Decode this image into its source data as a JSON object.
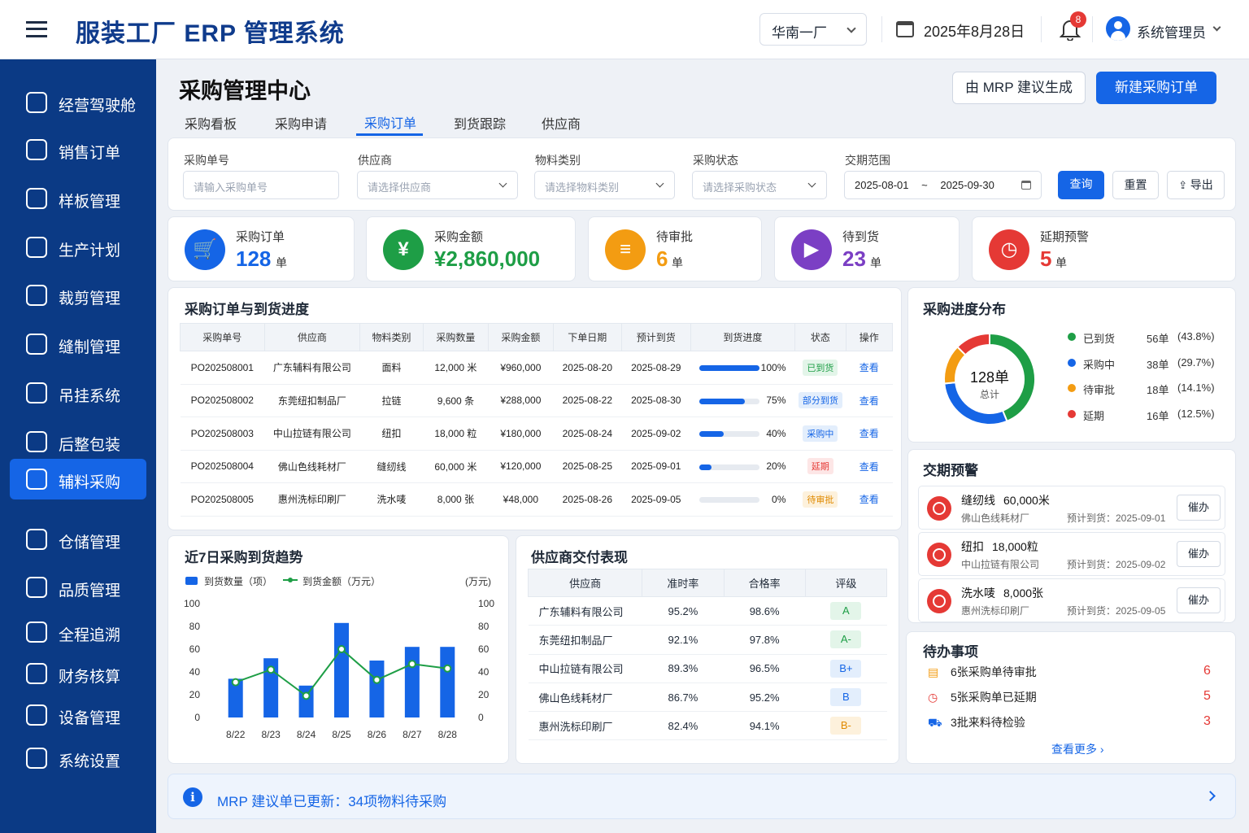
{
  "header": {
    "app_title": "服装工厂 ERP 管理系统",
    "factory": "华南一厂",
    "date": "2025年8月28日",
    "notify_count": "8",
    "user": "系统管理员"
  },
  "sidebar": {
    "items": [
      {
        "label": "经营驾驶舱",
        "icon": "dashboard-icon"
      },
      {
        "label": "销售订单",
        "icon": "document-icon"
      },
      {
        "label": "样板管理",
        "icon": "shirt-icon"
      },
      {
        "label": "生产计划",
        "icon": "calendar-icon"
      },
      {
        "label": "裁剪管理",
        "icon": "scissors-icon"
      },
      {
        "label": "缝制管理",
        "icon": "sewing-icon"
      },
      {
        "label": "吊挂系统",
        "icon": "hanger-icon"
      },
      {
        "label": "后整包装",
        "icon": "package-icon"
      },
      {
        "label": "辅料采购",
        "icon": "cart-icon",
        "active": true
      },
      {
        "label": "仓储管理",
        "icon": "warehouse-icon"
      },
      {
        "label": "品质管理",
        "icon": "shield-icon"
      },
      {
        "label": "全程追溯",
        "icon": "trace-icon"
      },
      {
        "label": "财务核算",
        "icon": "yen-icon"
      },
      {
        "label": "设备管理",
        "icon": "gear-icon"
      },
      {
        "label": "系统设置",
        "icon": "settings-icon"
      }
    ]
  },
  "page": {
    "title": "采购管理中心",
    "mrp_button": "由 MRP 建议生成",
    "new_button": "新建采购订单",
    "tabs": [
      "采购看板",
      "采购申请",
      "采购订单",
      "到货跟踪",
      "供应商"
    ],
    "active_tab": "采购订单"
  },
  "filters": {
    "order_no": {
      "label": "采购单号",
      "placeholder": "请输入采购单号"
    },
    "supplier": {
      "label": "供应商",
      "placeholder": "请选择供应商"
    },
    "category": {
      "label": "物料类别",
      "placeholder": "请选择物料类别"
    },
    "status": {
      "label": "采购状态",
      "placeholder": "请选择采购状态"
    },
    "date_range": {
      "label": "交期范围",
      "start": "2025-08-01",
      "sep": "~",
      "end": "2025-09-30"
    },
    "query": "查询",
    "reset": "重置",
    "export": "导出"
  },
  "kpis": [
    {
      "label": "采购订单",
      "value": "128",
      "unit": "单",
      "color": "#1565e6",
      "icon": "cart-icon"
    },
    {
      "label": "采购金额",
      "value": "¥2,860,000",
      "unit": "",
      "color": "#1e9e46",
      "icon": "money-icon"
    },
    {
      "label": "待审批",
      "value": "6",
      "unit": "单",
      "color": "#f39c12",
      "icon": "clipboard-icon"
    },
    {
      "label": "待到货",
      "value": "23",
      "unit": "单",
      "color": "#7b3fc4",
      "icon": "truck-icon"
    },
    {
      "label": "延期预警",
      "value": "5",
      "unit": "单",
      "color": "#e53935",
      "icon": "clock-icon"
    }
  ],
  "orders": {
    "title": "采购订单与到货进度",
    "headers": [
      "采购单号",
      "供应商",
      "物料类别",
      "采购数量",
      "采购金额",
      "下单日期",
      "预计到货",
      "到货进度",
      "状态",
      "操作"
    ],
    "rows": [
      {
        "no": "PO202508001",
        "supplier": "广东辅料有限公司",
        "cat": "面料",
        "qty": "12,000 米",
        "amt": "¥960,000",
        "order": "2025-08-20",
        "eta": "2025-08-29",
        "progress": 100,
        "pct": "100%",
        "status": "已到货",
        "status_color": "#1e9e46",
        "status_bg": "#e3f5e9",
        "action": "查看"
      },
      {
        "no": "PO202508002",
        "supplier": "东莞纽扣制品厂",
        "cat": "拉链",
        "qty": "9,600 条",
        "amt": "¥288,000",
        "order": "2025-08-22",
        "eta": "2025-08-30",
        "progress": 75,
        "pct": "75%",
        "status": "部分到货",
        "status_color": "#1565e6",
        "status_bg": "#e3eefc",
        "action": "查看"
      },
      {
        "no": "PO202508003",
        "supplier": "中山拉链有限公司",
        "cat": "纽扣",
        "qty": "18,000 粒",
        "amt": "¥180,000",
        "order": "2025-08-24",
        "eta": "2025-09-02",
        "progress": 40,
        "pct": "40%",
        "status": "采购中",
        "status_color": "#1565e6",
        "status_bg": "#e3eefc",
        "action": "查看"
      },
      {
        "no": "PO202508004",
        "supplier": "佛山色线耗材厂",
        "cat": "缝纫线",
        "qty": "60,000 米",
        "amt": "¥120,000",
        "order": "2025-08-25",
        "eta": "2025-09-01",
        "progress": 20,
        "pct": "20%",
        "status": "延期",
        "status_color": "#e53935",
        "status_bg": "#fde6e6",
        "action": "查看"
      },
      {
        "no": "PO202508005",
        "supplier": "惠州洗标印刷厂",
        "cat": "洗水唛",
        "qty": "8,000 张",
        "amt": "¥48,000",
        "order": "2025-08-26",
        "eta": "2025-09-05",
        "progress": 0,
        "pct": "0%",
        "status": "待审批",
        "status_color": "#e08a00",
        "status_bg": "#fdf1dc",
        "action": "查看"
      }
    ]
  },
  "donut": {
    "title": "采购进度分布",
    "center_value": "128单",
    "center_label": "总计",
    "items": [
      {
        "label": "已到货",
        "count": "56单",
        "pct": "(43.8%)",
        "value": 56,
        "color": "#1e9e46"
      },
      {
        "label": "采购中",
        "count": "38单",
        "pct": "(29.7%)",
        "value": 38,
        "color": "#1565e6"
      },
      {
        "label": "待审批",
        "count": "18单",
        "pct": "(14.1%)",
        "value": 18,
        "color": "#f39c12"
      },
      {
        "label": "延期",
        "count": "16单",
        "pct": "(12.5%)",
        "value": 16,
        "color": "#e53935"
      }
    ]
  },
  "warnings": {
    "title": "交期预警",
    "items": [
      {
        "name": "缝纫线",
        "qty": "60,000米",
        "supplier": "佛山色线耗材厂",
        "eta": "预计到货：2025-09-01",
        "action": "催办"
      },
      {
        "name": "纽扣",
        "qty": "18,000粒",
        "supplier": "中山拉链有限公司",
        "eta": "预计到货：2025-09-02",
        "action": "催办"
      },
      {
        "name": "洗水唛",
        "qty": "8,000张",
        "supplier": "惠州洗标印刷厂",
        "eta": "预计到货：2025-09-05",
        "action": "催办"
      }
    ]
  },
  "chart_data": {
    "type": "bar",
    "title": "近7日采购到货趋势",
    "categories": [
      "8/22",
      "8/23",
      "8/24",
      "8/25",
      "8/26",
      "8/27",
      "8/28"
    ],
    "series": [
      {
        "name": "到货数量（项）",
        "type": "bar",
        "values": [
          34,
          52,
          28,
          83,
          50,
          62,
          62
        ],
        "color": "#1565e6"
      },
      {
        "name": "到货金额（万元）",
        "type": "line",
        "values": [
          31,
          42,
          19,
          60,
          33,
          47,
          43
        ],
        "color": "#1e9e46"
      }
    ],
    "ylim": [
      0,
      100
    ],
    "yticks": [
      0,
      20,
      40,
      60,
      80,
      100
    ],
    "y2label": "(万元)",
    "y2lim": [
      0,
      100
    ],
    "legend": "top-left",
    "grid": false
  },
  "suppliers": {
    "title": "供应商交付表现",
    "headers": [
      "供应商",
      "准时率",
      "合格率",
      "评级"
    ],
    "rows": [
      {
        "name": "广东辅料有限公司",
        "ontime": "95.2%",
        "pass": "98.6%",
        "grade": "A",
        "color": "#1e9e46",
        "bg": "#e3f5e9"
      },
      {
        "name": "东莞纽扣制品厂",
        "ontime": "92.1%",
        "pass": "97.8%",
        "grade": "A-",
        "color": "#1e9e46",
        "bg": "#e3f5e9"
      },
      {
        "name": "中山拉链有限公司",
        "ontime": "89.3%",
        "pass": "96.5%",
        "grade": "B+",
        "color": "#1565e6",
        "bg": "#e3eefc"
      },
      {
        "name": "佛山色线耗材厂",
        "ontime": "86.7%",
        "pass": "95.2%",
        "grade": "B",
        "color": "#1565e6",
        "bg": "#e3eefc"
      },
      {
        "name": "惠州洗标印刷厂",
        "ontime": "82.4%",
        "pass": "94.1%",
        "grade": "B-",
        "color": "#e08a00",
        "bg": "#fdf1dc"
      }
    ]
  },
  "todos": {
    "title": "待办事项",
    "items": [
      {
        "text": "6张采购单待审批",
        "count": "6",
        "icon": "document-icon",
        "color": "#f39c12"
      },
      {
        "text": "5张采购单已延期",
        "count": "5",
        "icon": "clock-icon",
        "color": "#e53935"
      },
      {
        "text": "3批来料待检验",
        "count": "3",
        "icon": "truck-icon",
        "color": "#1565e6"
      }
    ],
    "more": "查看更多 ›"
  },
  "banner": {
    "text": "MRP 建议单已更新：34项物料待采购"
  }
}
